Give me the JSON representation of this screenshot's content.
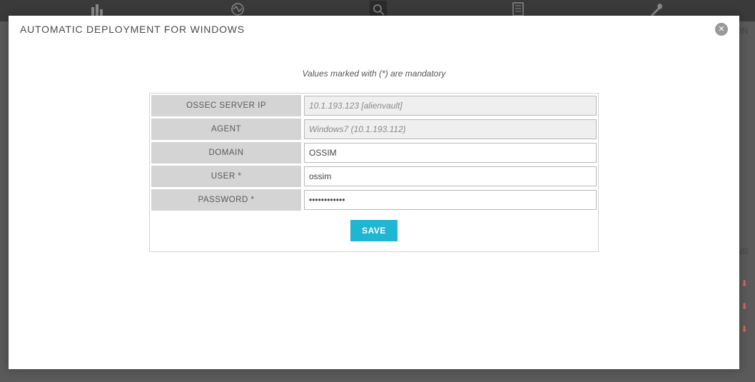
{
  "background": {
    "text_on": "ON",
    "text_ns": "NS"
  },
  "modal": {
    "title": "AUTOMATIC DEPLOYMENT FOR WINDOWS",
    "mandatory_note": "Values marked with (*) are mandatory",
    "form": {
      "ossec_server_ip": {
        "label": "OSSEC SERVER IP",
        "value": "10.1.193.123 [alienvault]"
      },
      "agent": {
        "label": "AGENT",
        "value": "Windows7 (10.1.193.112)"
      },
      "domain": {
        "label": "DOMAIN",
        "value": "OSSIM"
      },
      "user": {
        "label": "USER *",
        "value": "ossim"
      },
      "password": {
        "label": "PASSWORD *",
        "value": "••••••••••••"
      }
    },
    "save_label": "SAVE"
  }
}
